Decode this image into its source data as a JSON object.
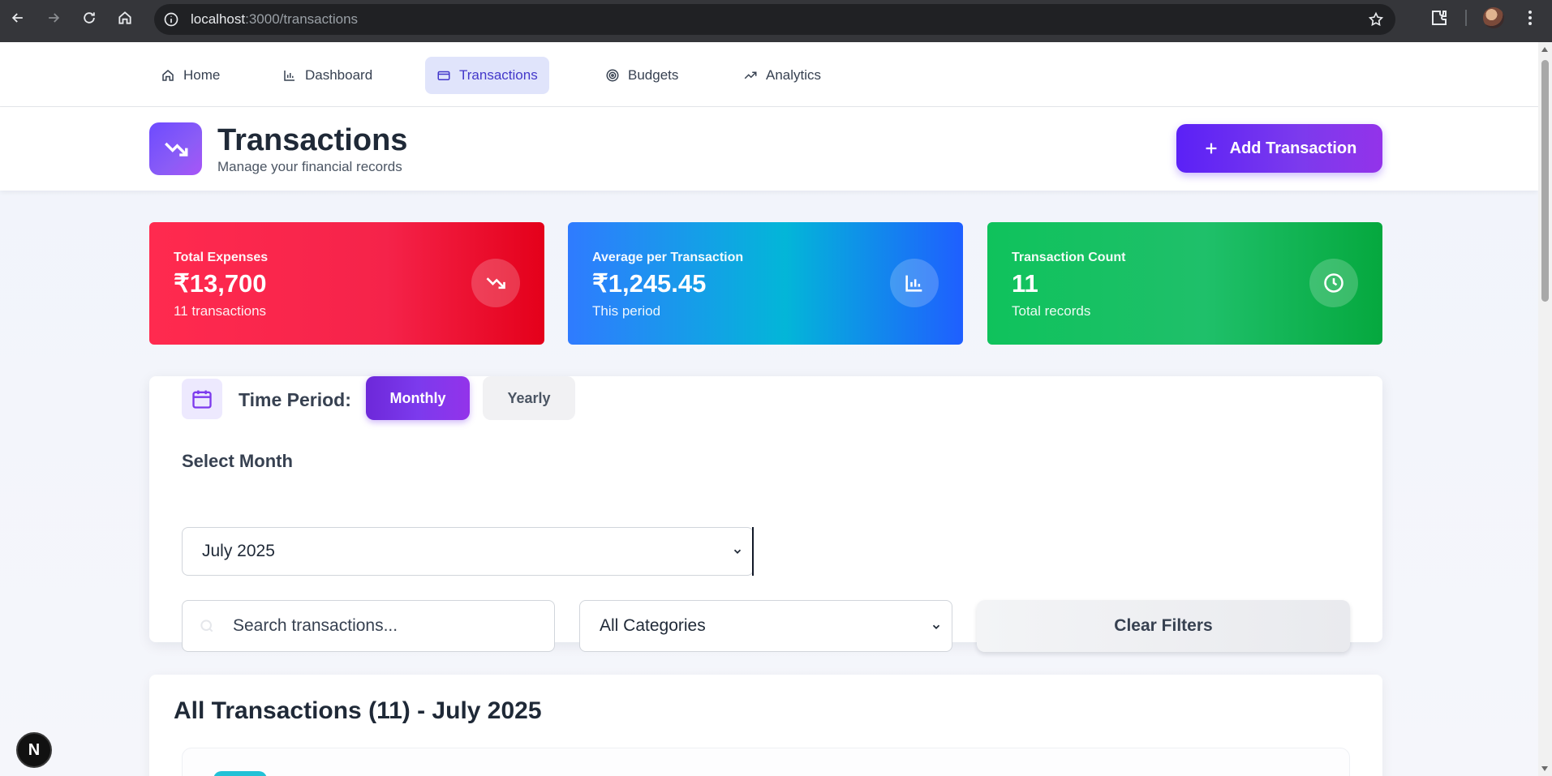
{
  "browser": {
    "url_host": "localhost",
    "url_rest": ":3000/transactions"
  },
  "nav": {
    "items": [
      {
        "label": "Home",
        "icon": "home-icon"
      },
      {
        "label": "Dashboard",
        "icon": "bar-chart-icon"
      },
      {
        "label": "Transactions",
        "icon": "credit-card-icon",
        "active": true
      },
      {
        "label": "Budgets",
        "icon": "target-icon"
      },
      {
        "label": "Analytics",
        "icon": "trending-up-icon"
      }
    ]
  },
  "header": {
    "title": "Transactions",
    "subtitle": "Manage your financial records",
    "add_button_label": "Add Transaction"
  },
  "stats": [
    {
      "label": "Total Expenses",
      "value": "₹13,700",
      "sub": "11 transactions",
      "icon": "trending-down-icon",
      "color": "#ff2a4f"
    },
    {
      "label": "Average per Transaction",
      "value": "₹1,245.45",
      "sub": "This period",
      "icon": "bar-chart-icon",
      "color": "#2f7bff"
    },
    {
      "label": "Transaction Count",
      "value": "11",
      "sub": "Total records",
      "icon": "clock-icon",
      "color": "#0fc25c"
    }
  ],
  "filters": {
    "time_period_label": "Time Period:",
    "monthly_label": "Monthly",
    "yearly_label": "Yearly",
    "selected_period": "Monthly",
    "select_month_label": "Select Month",
    "selected_month": "July 2025",
    "search_placeholder": "Search transactions...",
    "category_value": "All Categories",
    "clear_label": "Clear Filters"
  },
  "list": {
    "title": "All Transactions (11) - July 2025"
  },
  "dev_badge": "N",
  "colors": {
    "accent": "#7c3aed",
    "nav_active_bg": "#e0e4fb",
    "nav_active_text": "#4338ca"
  }
}
